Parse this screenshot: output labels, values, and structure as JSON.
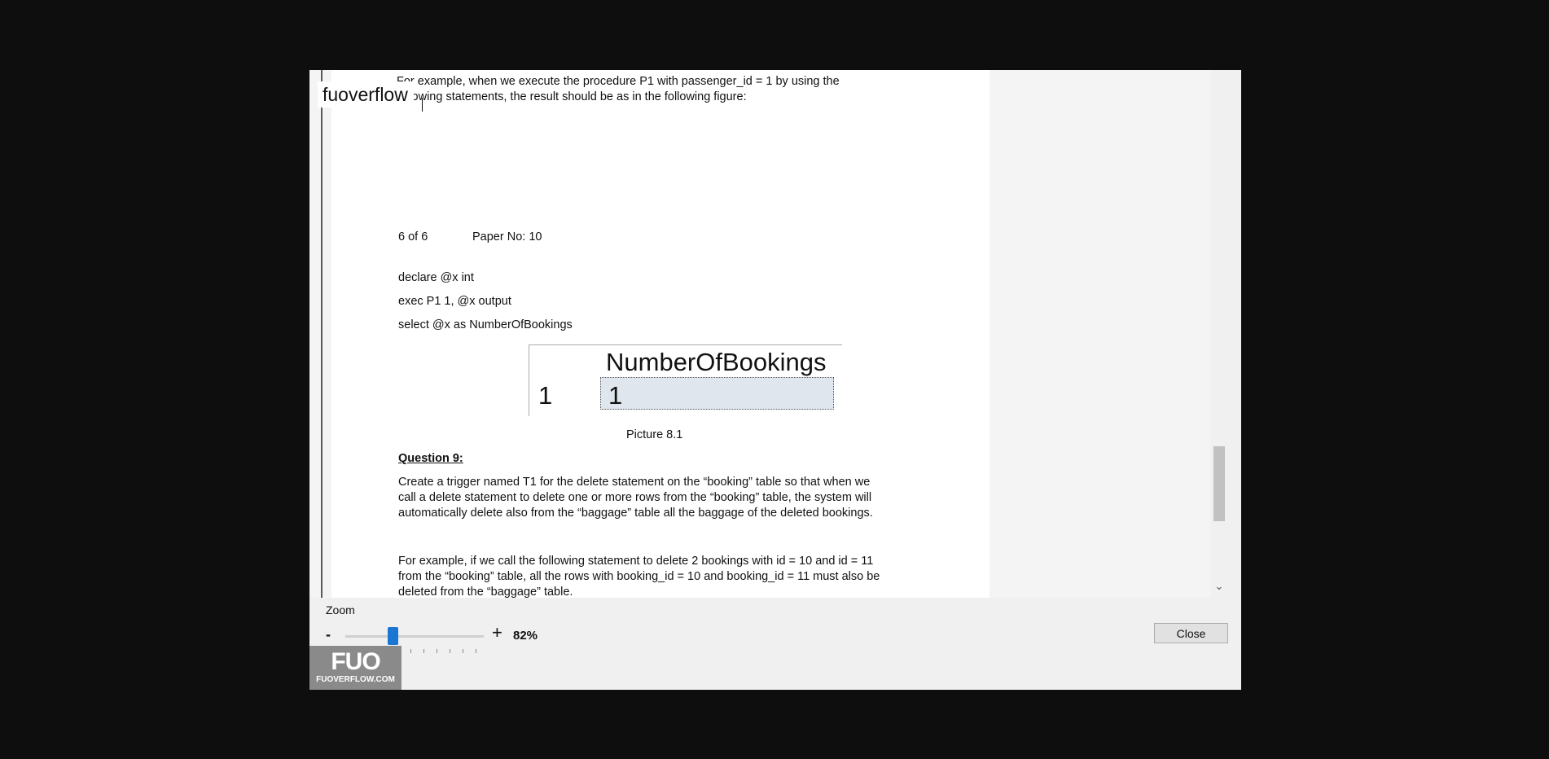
{
  "brand": {
    "name": "fuoverflow"
  },
  "document": {
    "intro_line1": "For example, when we execute the procedure P1 with passenger_id = 1 by using the",
    "intro_line2": "following statements, the result should be as in the following figure:",
    "page_count": "6 of 6",
    "paper_no": "Paper No: 10",
    "code_line1": "declare @x int",
    "code_line2": "exec P1 1, @x output",
    "code_line3": "select @x as NumberOfBookings",
    "result_grid": {
      "column": "NumberOfBookings",
      "row_number": "1",
      "value": "1"
    },
    "caption": "Picture 8.1",
    "question_heading": "Question 9:",
    "q9_line1": "Create a trigger named T1 for the delete statement on the “booking” table so that when we",
    "q9_line2": "call a delete statement to delete one or more rows from the “booking” table, the system will",
    "q9_line3": "automatically delete also from the “baggage” table all the baggage of the deleted bookings.",
    "ex_line1": "For example, if we call the following statement to delete 2 bookings with id = 10 and id = 11",
    "ex_line2": "from the “booking” table, all the rows with booking_id = 10 and booking_id = 11 must also be",
    "ex_line3": "deleted from the “baggage” table."
  },
  "zoom": {
    "label": "Zoom",
    "minus": "-",
    "plus": "+",
    "value": "82%",
    "level_percent": 82
  },
  "buttons": {
    "close": "Close"
  },
  "logo": {
    "mark": "FUO",
    "text": "FUOVERFLOW.COM"
  },
  "icons": {
    "scroll_down": "chevron-down-icon"
  }
}
